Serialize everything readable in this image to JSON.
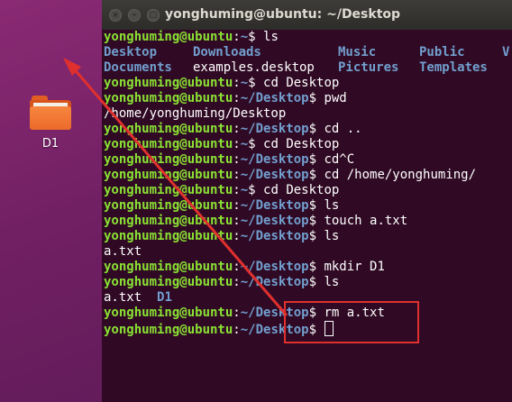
{
  "desktop": {
    "folder_label": "D1"
  },
  "terminal": {
    "title": "yonghuming@ubuntu: ~/Desktop",
    "window_buttons": [
      "×",
      "–",
      "□"
    ],
    "prompt_user": "yonghuming@ubuntu",
    "lines": [
      {
        "cwd": "~",
        "cmd": "ls"
      },
      {
        "type": "cols",
        "items": [
          "Desktop",
          "Downloads",
          "Music",
          "Public",
          "V"
        ],
        "kinds": [
          "d",
          "d",
          "d",
          "d",
          "d"
        ]
      },
      {
        "type": "cols",
        "items": [
          "Documents",
          "examples.desktop",
          "Pictures",
          "Templates",
          ""
        ],
        "kinds": [
          "d",
          "f",
          "d",
          "d",
          "f"
        ]
      },
      {
        "cwd": "~",
        "cmd": "cd Desktop"
      },
      {
        "cwd": "~/Desktop",
        "cmd": "pwd"
      },
      {
        "type": "out",
        "text": "/home/yonghuming/Desktop"
      },
      {
        "cwd": "~/Desktop",
        "cmd": "cd .."
      },
      {
        "cwd": "~",
        "cmd": "cd Desktop"
      },
      {
        "cwd": "~/Desktop",
        "cmd": "cd^C"
      },
      {
        "cwd": "~/Desktop",
        "cmd": "cd /home/yonghuming/"
      },
      {
        "cwd": "~",
        "cmd": "cd Desktop"
      },
      {
        "cwd": "~/Desktop",
        "cmd": "ls"
      },
      {
        "cwd": "~/Desktop",
        "cmd": "touch a.txt"
      },
      {
        "cwd": "~/Desktop",
        "cmd": "ls"
      },
      {
        "type": "out",
        "text": "a.txt"
      },
      {
        "cwd": "~/Desktop",
        "cmd": "mkdir D1"
      },
      {
        "cwd": "~/Desktop",
        "cmd": "ls"
      },
      {
        "type": "mixed",
        "parts": [
          {
            "text": "a.txt  ",
            "kind": "f"
          },
          {
            "text": "D1",
            "kind": "d"
          }
        ]
      },
      {
        "cwd": "~/Desktop",
        "cmd": "rm a.txt"
      },
      {
        "cwd": "~/Desktop",
        "cmd": "",
        "cursor": true
      }
    ]
  },
  "colors": {
    "desktop_bg": "#7a2468",
    "terminal_bg": "#300a24",
    "prompt_user": "#8ae234",
    "prompt_path": "#729fcf",
    "annotation": "#e0302e"
  }
}
